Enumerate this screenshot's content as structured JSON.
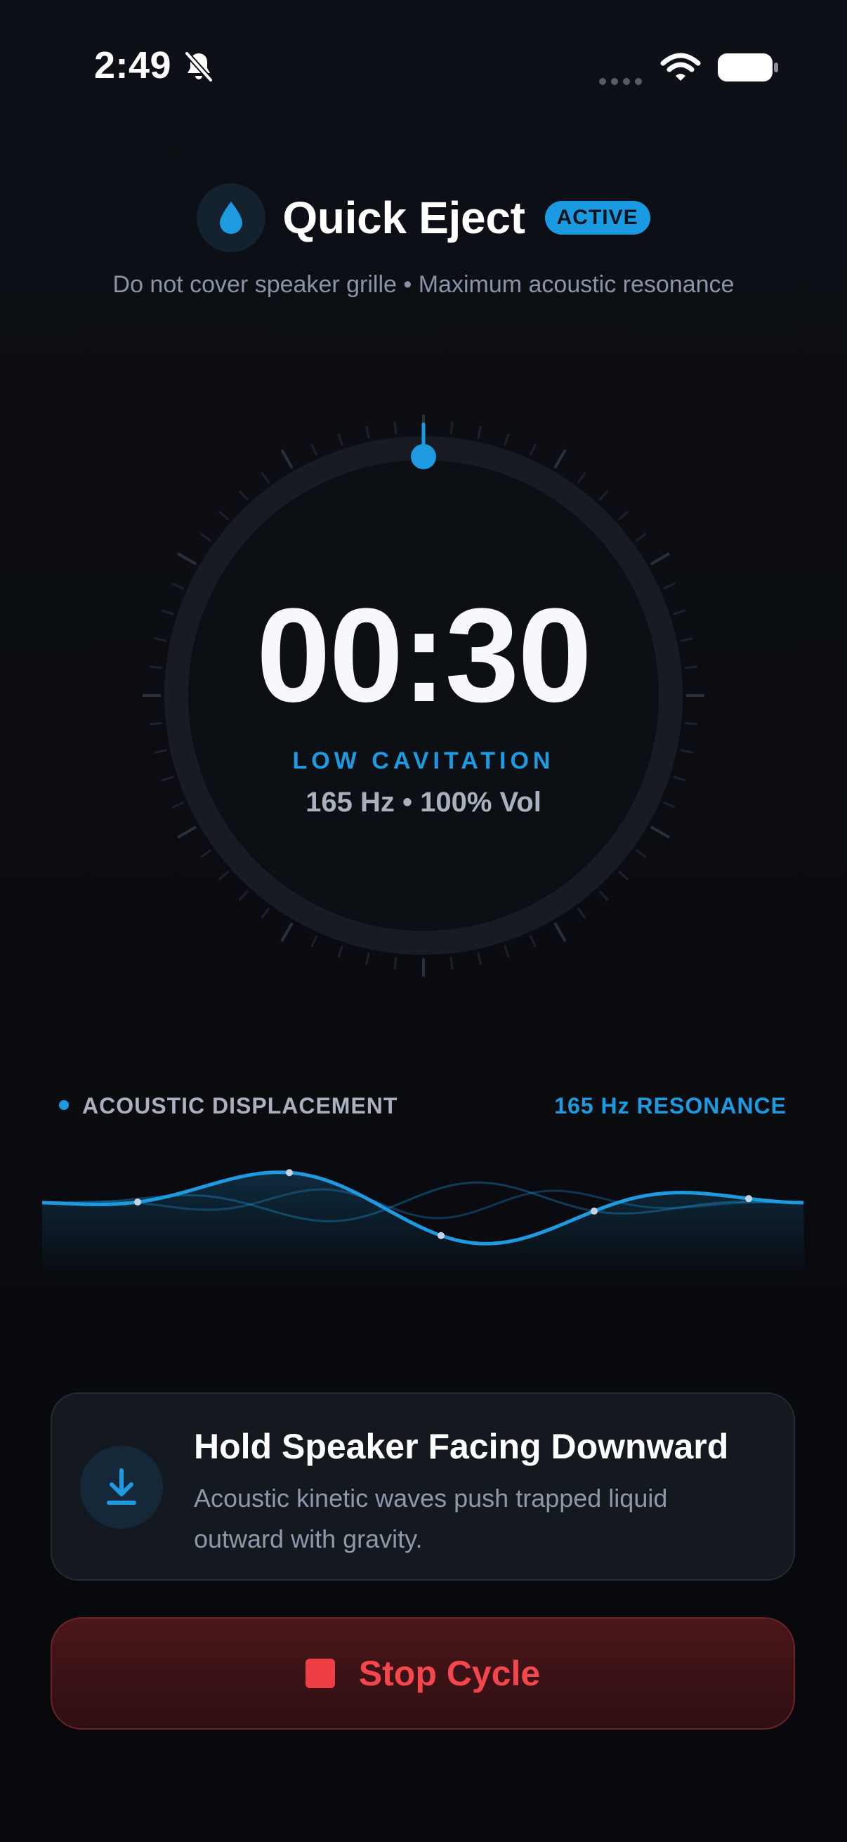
{
  "status_bar": {
    "time": "2:49",
    "icons": [
      "bell-slash-icon",
      "signal-dots-icon",
      "wifi-icon",
      "battery-icon"
    ]
  },
  "header": {
    "icon": "water-drop-icon",
    "title": "Quick Eject",
    "badge": "ACTIVE",
    "subtitle": "Do not cover speaker grille • Maximum acoustic resonance"
  },
  "dial": {
    "timer": "00:30",
    "mode": "LOW CAVITATION",
    "details": "165 Hz • 100% Vol"
  },
  "waveform": {
    "left_label": "ACOUSTIC DISPLACEMENT",
    "right_label": "165 Hz RESONANCE"
  },
  "instruction": {
    "icon": "download-arrow-icon",
    "title": "Hold Speaker Facing Downward",
    "body": "Acoustic kinetic waves push trapped liquid outward with gravity."
  },
  "stop_button": {
    "icon": "stop-square-icon",
    "label": "Stop Cycle"
  },
  "colors": {
    "accent": "#1e9be0",
    "danger": "#f3474d",
    "background": "#0b0d12"
  }
}
